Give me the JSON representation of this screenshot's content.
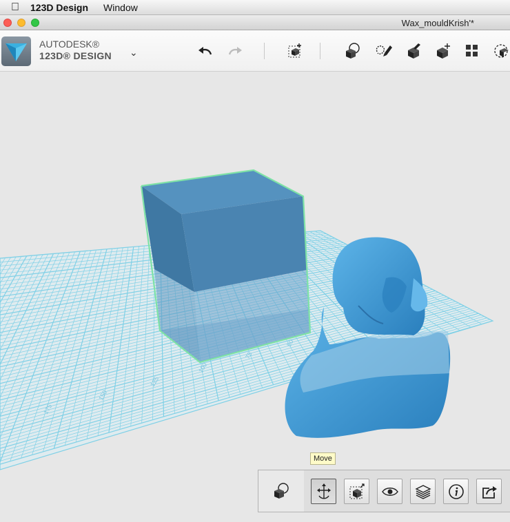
{
  "menubar": {
    "apple_icon": "apple-icon",
    "app_name": "123D Design",
    "menu_window": "Window"
  },
  "window": {
    "document_title": "Wax_mouldKrish'*"
  },
  "logo": {
    "line1": "AUTODESK®",
    "line2": "123D® DESIGN"
  },
  "toolbar": {
    "icons": [
      "undo-icon",
      "redo-icon",
      "transform-icon",
      "primitives-icon",
      "sketch-icon",
      "construct-icon",
      "modify-icon",
      "pattern-icon",
      "grouping-icon"
    ]
  },
  "tooltip": {
    "text": "Move"
  },
  "bottom_toolbar": {
    "icons": [
      "solid-selection-icon",
      "move-icon",
      "smart-scale-icon",
      "visibility-icon",
      "layers-icon",
      "info-icon",
      "export-icon"
    ],
    "active": "move-icon"
  },
  "colors": {
    "grid": "#7fd0e6",
    "cube": "#4f8db9",
    "cube_edge": "#7fe2a6",
    "bust": "#3b97d2"
  },
  "grid_labels": [
    "25",
    "50",
    "75",
    "100",
    "125",
    "150",
    "175"
  ]
}
